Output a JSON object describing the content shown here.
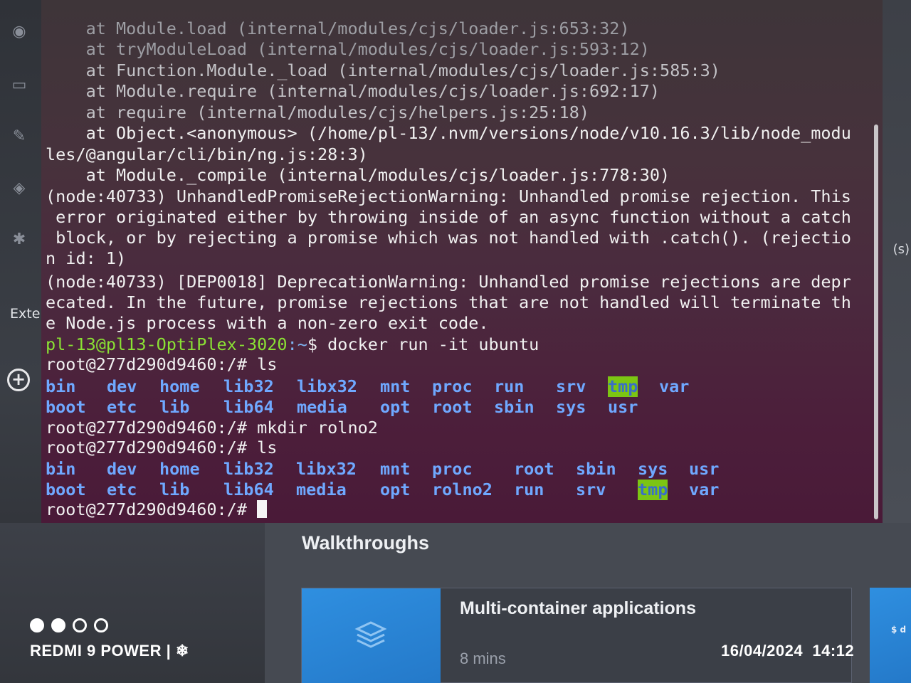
{
  "terminal": {
    "lines": [
      "    at Module.load (internal/modules/cjs/loader.js:653:32)",
      "    at tryModuleLoad (internal/modules/cjs/loader.js:593:12)",
      "    at Function.Module._load (internal/modules/cjs/loader.js:585:3)",
      "    at Module.require (internal/modules/cjs/loader.js:692:17)",
      "    at require (internal/modules/cjs/helpers.js:25:18)",
      "    at Object.<anonymous> (/home/pl-13/.nvm/versions/node/v10.16.3/lib/node_modu",
      "les/@angular/cli/bin/ng.js:28:3)",
      "    at Module._compile (internal/modules/cjs/loader.js:778:30)",
      "(node:40733) UnhandledPromiseRejectionWarning: Unhandled promise rejection. This",
      " error originated either by throwing inside of an async function without a catch",
      " block, or by rejecting a promise which was not handled with .catch(). (rejectio",
      "n id: 1)",
      "(node:40733) [DEP0018] DeprecationWarning: Unhandled promise rejections are depr",
      "ecated. In the future, promise rejections that are not handled will terminate th",
      "e Node.js process with a non-zero exit code."
    ],
    "host_prompt": {
      "user_host": "pl-13@pl13-OptiPlex-3020",
      "path": ":~",
      "symbol": "$ ",
      "command": "docker run -it ubuntu"
    },
    "root_prompt": "root@277d290d9460:/# ",
    "cmd_ls_1": "ls",
    "ls1_row1": [
      "bin",
      "dev",
      "home",
      "lib32",
      "libx32",
      "mnt",
      "proc",
      "run",
      "srv",
      "tmp",
      "var"
    ],
    "ls1_row2": [
      "boot",
      "etc",
      "lib",
      "lib64",
      "media",
      "opt",
      "root",
      "sbin",
      "sys",
      "usr"
    ],
    "cmd_mkdir": "mkdir rolno2",
    "cmd_ls_2": "ls",
    "ls2_row1": [
      "bin",
      "dev",
      "home",
      "lib32",
      "libx32",
      "mnt",
      "proc",
      "root",
      "sbin",
      "sys",
      "usr"
    ],
    "ls2_row2": [
      "boot",
      "etc",
      "lib",
      "lib64",
      "media",
      "opt",
      "rolno2",
      "run",
      "srv",
      "tmp",
      "var"
    ],
    "highlight_dir": "tmp"
  },
  "sidebar": {
    "extensions_label": "Exte",
    "right_label": "(s)"
  },
  "walkthroughs": {
    "title": "Walkthroughs",
    "card_title": "Multi-container applications",
    "card_time": "8 mins",
    "next_card_text": "$ d"
  },
  "camera": {
    "brand": "REDMI 9 POWER | ❄",
    "date": "16/04/2024",
    "time": "14:12"
  },
  "colors": {
    "prompt_user": "#8ae234",
    "prompt_path": "#7eb3f0",
    "dir": "#6fa8ff",
    "tmp_highlight": "#7cc513"
  }
}
